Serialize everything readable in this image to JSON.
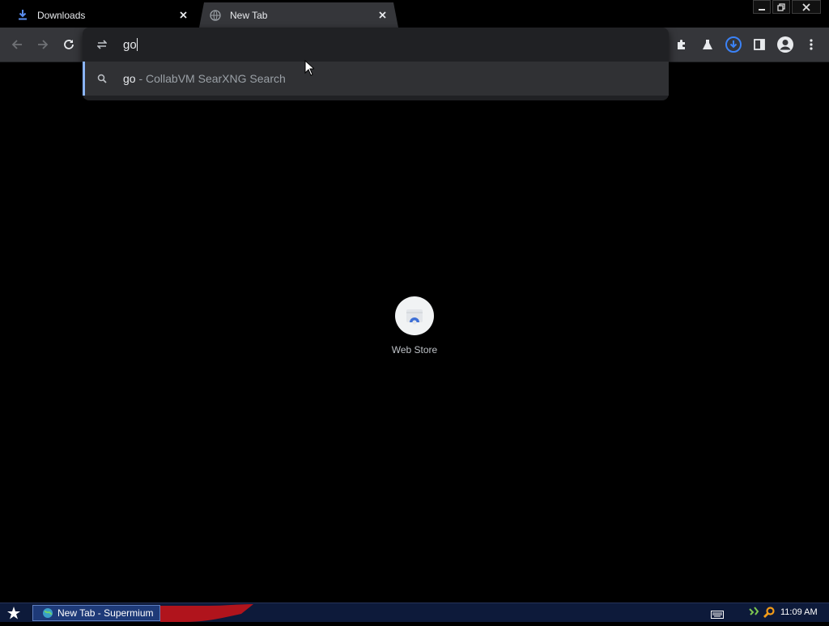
{
  "window": {
    "tabs": [
      {
        "label": "Downloads",
        "icon": "download-icon",
        "active": false
      },
      {
        "label": "New Tab",
        "icon": "globe-icon",
        "active": true
      }
    ]
  },
  "omnibox": {
    "value": "go",
    "suggestions": [
      {
        "query": "go",
        "separator": " - ",
        "engine": "CollabVM SearXNG Search",
        "icon": "search-icon"
      }
    ]
  },
  "ntp": {
    "shortcuts": [
      {
        "label": "Web Store",
        "icon": "web-store-icon"
      }
    ]
  },
  "taskbar": {
    "task_label": "New Tab - Supermium",
    "clock": "11:09 AM"
  },
  "colors": {
    "toolbar": "#35363a",
    "dropdown": "#202124",
    "accent": "#8ab4f8",
    "download_active": "#3b82f6",
    "taskbar": "#0d1a3a"
  }
}
